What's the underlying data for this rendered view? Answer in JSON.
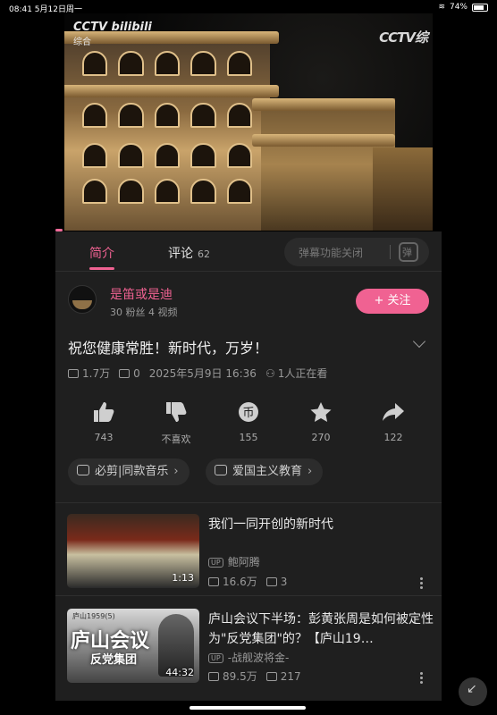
{
  "status_bar": {
    "time_date": "08:41  5月12日周一",
    "battery": "74%"
  },
  "video": {
    "logo_left": "CCTV bilibili",
    "logo_left_sub": "综合",
    "logo_right": "CCTV综"
  },
  "tabs": {
    "intro": "简介",
    "comments": "评论",
    "comment_count": "62"
  },
  "danmu": {
    "label": "弹幕功能关闭"
  },
  "author": {
    "name": "是笛或是迪",
    "meta": "30 粉丝   4 视频",
    "follow_label": "+ 关注"
  },
  "video_info": {
    "title": "祝您健康常胜！新时代，万岁！",
    "views": "1.7万",
    "danmaku": "0",
    "date": "2025年5月9日 16:36",
    "watching": "1人正在看"
  },
  "actions": {
    "like": "743",
    "dislike": "不喜欢",
    "coin": "155",
    "favorite": "270",
    "share": "122"
  },
  "tags": [
    {
      "label": "必剪|同款音乐"
    },
    {
      "label": "爱国主义教育"
    }
  ],
  "recommendations": [
    {
      "title": "我们一同开创的新时代",
      "uploader": "鲍阿腾",
      "views": "16.6万",
      "danmaku": "3",
      "duration": "1:13",
      "thumb_text": "",
      "thumb_sub": ""
    },
    {
      "title": "庐山会议下半场：彭黄张周是如何被定性为\"反党集团\"的？【庐山19…",
      "uploader": "-战舰波将金-",
      "views": "89.5万",
      "danmaku": "217",
      "duration": "44:32",
      "thumb_top": "庐山1959(5)",
      "thumb_text": "庐山会议",
      "thumb_sub": "反党集团"
    }
  ],
  "colors": {
    "accent": "#f06292",
    "panel": "#1f1f1f",
    "background": "#000000"
  }
}
